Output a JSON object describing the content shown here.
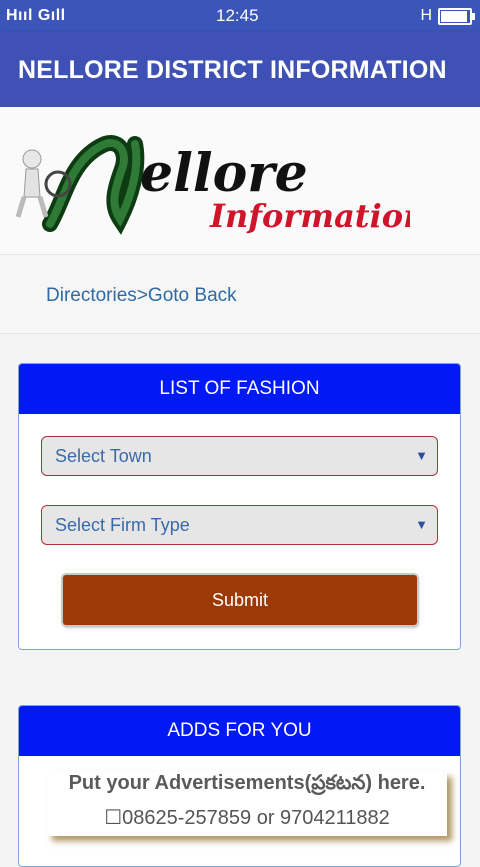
{
  "status_bar": {
    "signal_text": "Hııl Gıll",
    "time": "12:45",
    "net_text": "H"
  },
  "app_bar": {
    "title": "NELLORE DISTRICT INFORMATION"
  },
  "logo": {
    "word1": "ellore",
    "word2": "Information"
  },
  "breadcrumb": {
    "directories": "Directories",
    "separator": ">",
    "back": "Goto Back"
  },
  "fashion_panel": {
    "title": "LIST OF FASHION",
    "town_select": "Select Town",
    "firm_select": "Select Firm Type",
    "submit_label": "Submit"
  },
  "ads_panel": {
    "title": "ADDS FOR YOU",
    "line1": "Put your Advertisements(ప్రకటన) here.",
    "line2": "08625-257859 or 9704211882"
  },
  "colors": {
    "app_bar": "#3f51b5",
    "panel_header": "#0019f5",
    "submit": "#9b3a04",
    "select_border": "#b0303a"
  }
}
